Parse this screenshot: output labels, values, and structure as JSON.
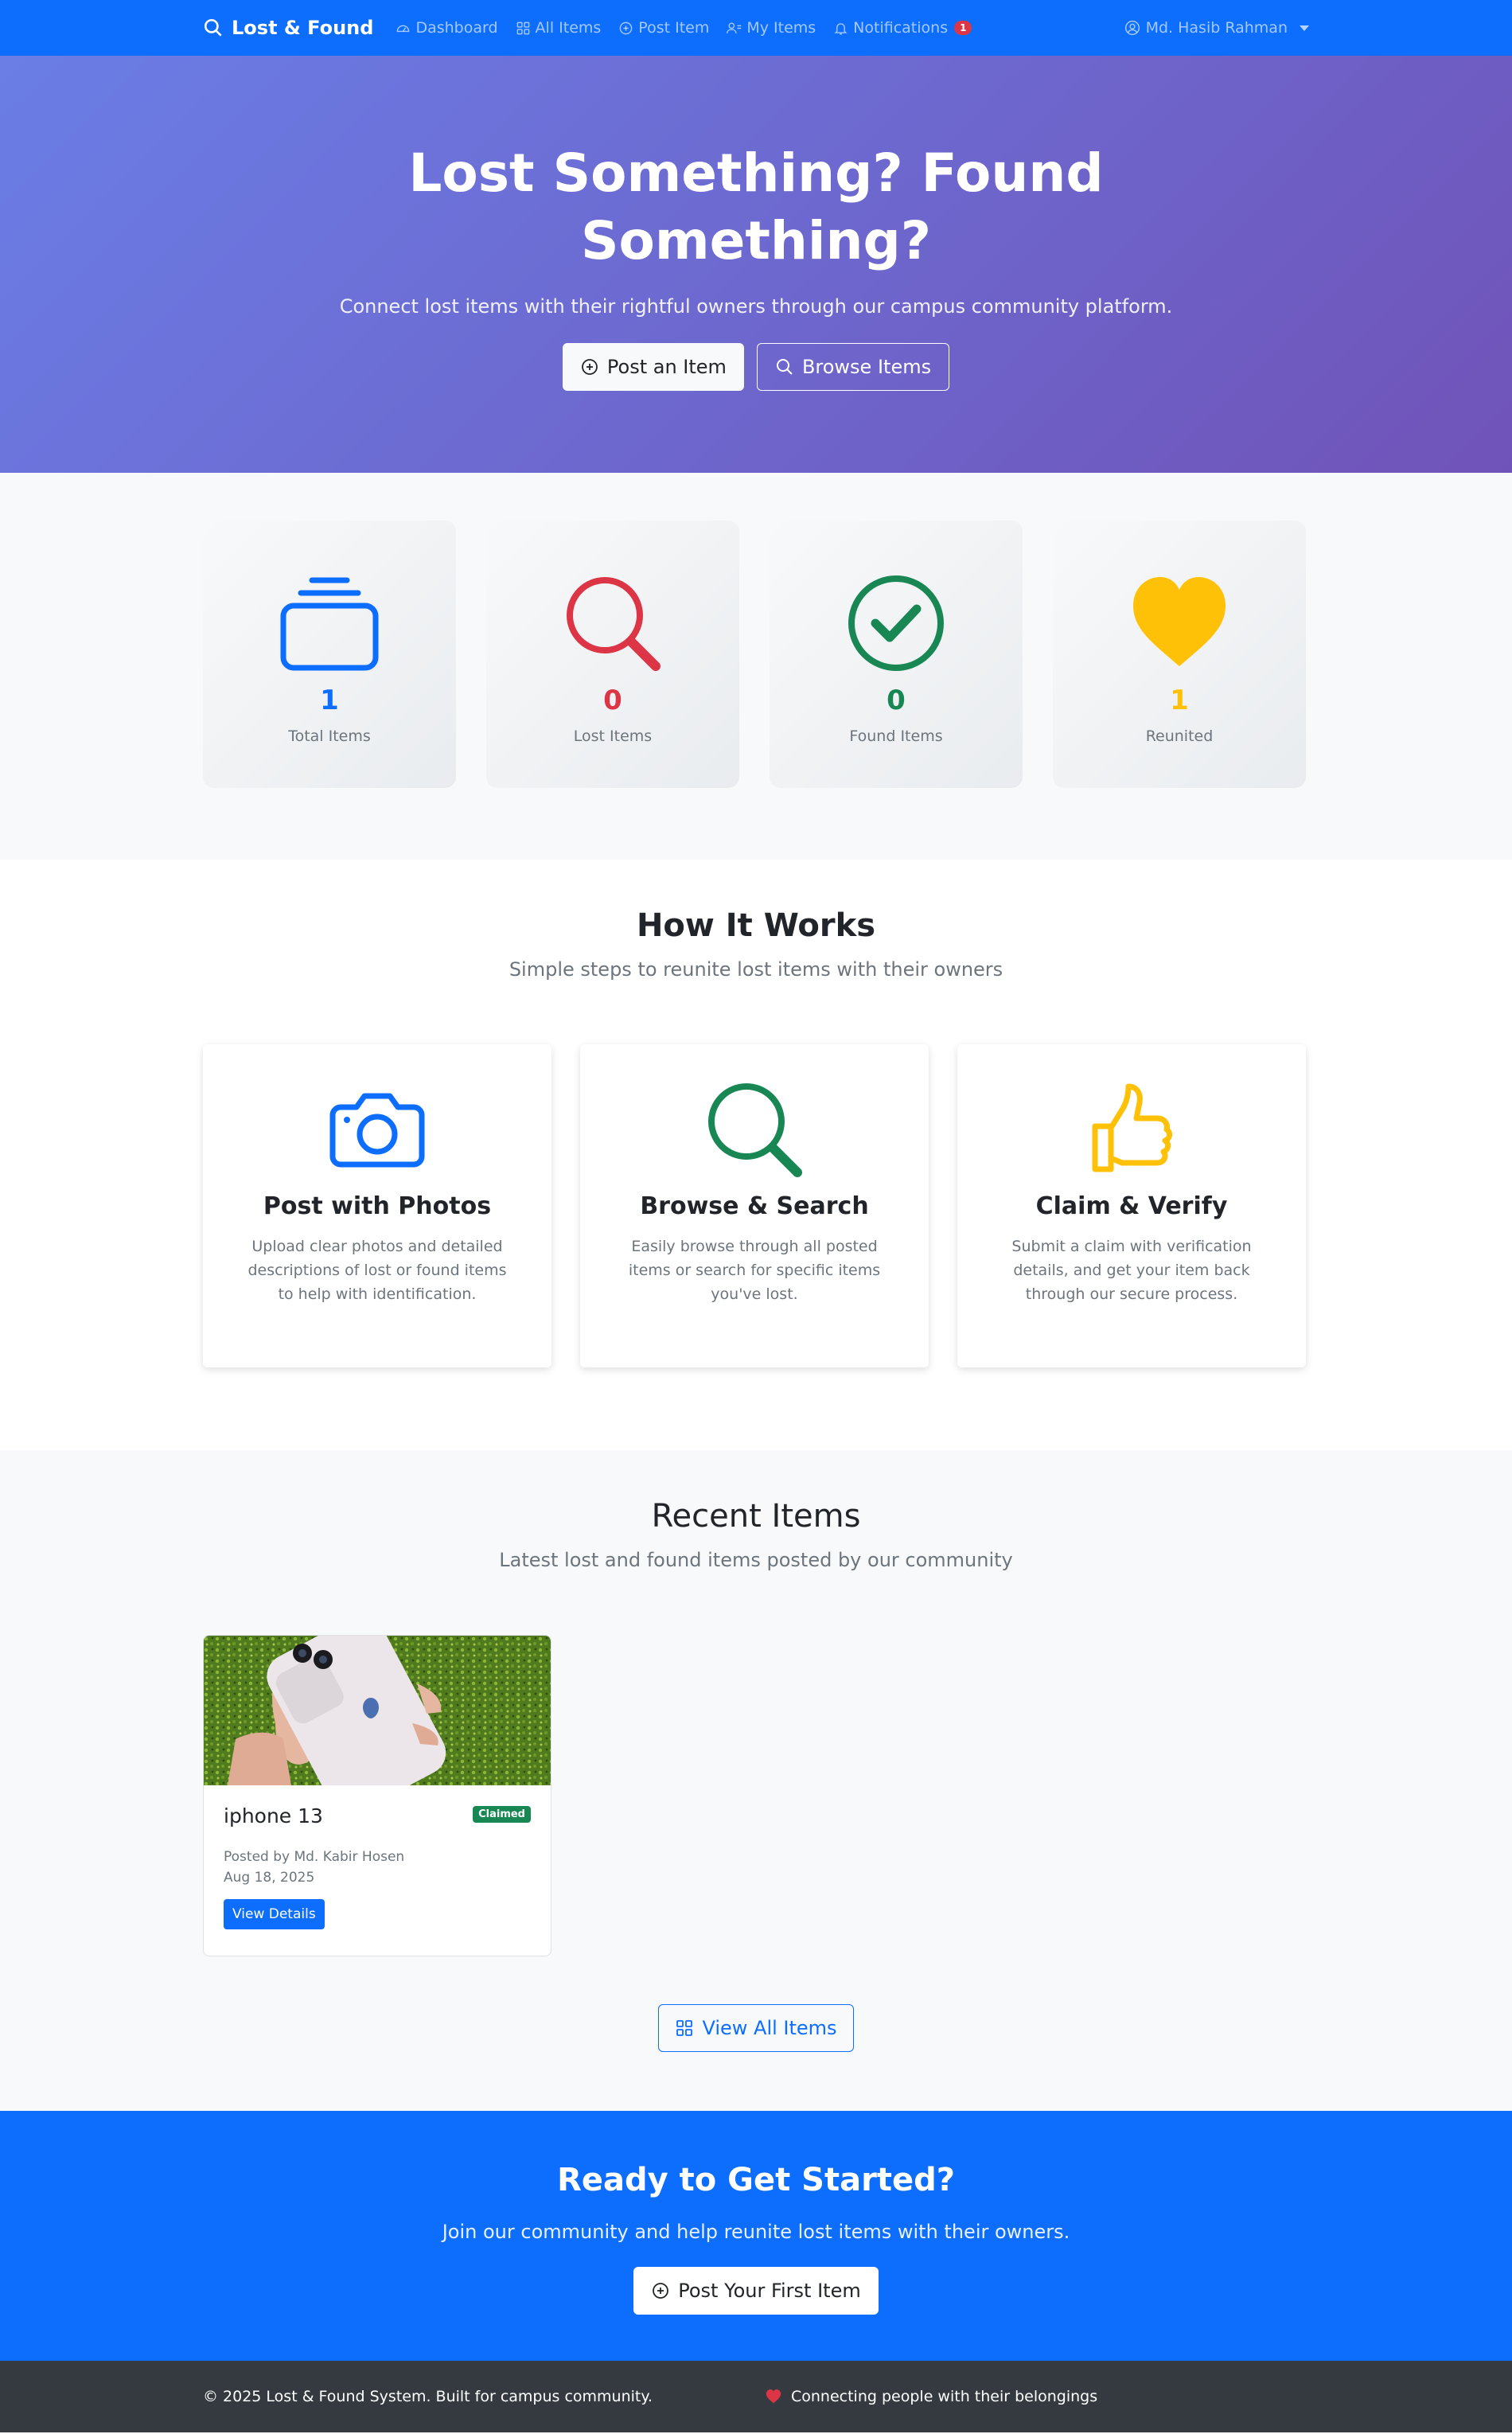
{
  "navbar": {
    "brand": "Lost & Found",
    "links": [
      {
        "label": "Dashboard",
        "icon": "speedometer-icon"
      },
      {
        "label": "All Items",
        "icon": "grid-icon"
      },
      {
        "label": "Post Item",
        "icon": "plus-circle-icon"
      },
      {
        "label": "My Items",
        "icon": "person-list-icon"
      },
      {
        "label": "Notifications",
        "icon": "bell-icon"
      }
    ],
    "notification_count": "1",
    "user_name": "Md. Hasib Rahman"
  },
  "hero": {
    "title": "Lost Something? Found Something?",
    "subtitle": "Connect lost items with their rightful owners through our campus community platform.",
    "post_button": "Post an Item",
    "browse_button": "Browse Items"
  },
  "stats": [
    {
      "value": "1",
      "label": "Total Items",
      "color": "#0d6efd",
      "icon": "collection-icon"
    },
    {
      "value": "0",
      "label": "Lost Items",
      "color": "#dc3545",
      "icon": "search-icon"
    },
    {
      "value": "0",
      "label": "Found Items",
      "color": "#198754",
      "icon": "check-circle-icon"
    },
    {
      "value": "1",
      "label": "Reunited",
      "color": "#ffc107",
      "icon": "heart-icon"
    }
  ],
  "how_it_works": {
    "title": "How It Works",
    "subtitle": "Simple steps to reunite lost items with their owners",
    "steps": [
      {
        "title": "Post with Photos",
        "description": "Upload clear photos and detailed descriptions of lost or found items to help with identification.",
        "icon": "camera-icon",
        "color": "#0d6efd"
      },
      {
        "title": "Browse & Search",
        "description": "Easily browse through all posted items or search for specific items you've lost.",
        "icon": "search-icon",
        "color": "#198754"
      },
      {
        "title": "Claim & Verify",
        "description": "Submit a claim with verification details, and get your item back through our secure process.",
        "icon": "thumbs-up-icon",
        "color": "#ffc107"
      }
    ]
  },
  "recent_items": {
    "title": "Recent Items",
    "subtitle": "Latest lost and found items posted by our community",
    "items": [
      {
        "title": "iphone 13",
        "status": "Claimed",
        "posted_by": "Posted by Md. Kabir Hosen",
        "date": "Aug 18, 2025",
        "button": "View Details",
        "image": "phone-in-hand-photo"
      }
    ],
    "view_all": "View All Items"
  },
  "cta": {
    "title": "Ready to Get Started?",
    "subtitle": "Join our community and help reunite lost items with their owners.",
    "button": "Post Your First Item"
  },
  "footer": {
    "copyright": "© 2025 Lost & Found System. Built for campus community.",
    "tagline": "Connecting people with their belongings"
  }
}
